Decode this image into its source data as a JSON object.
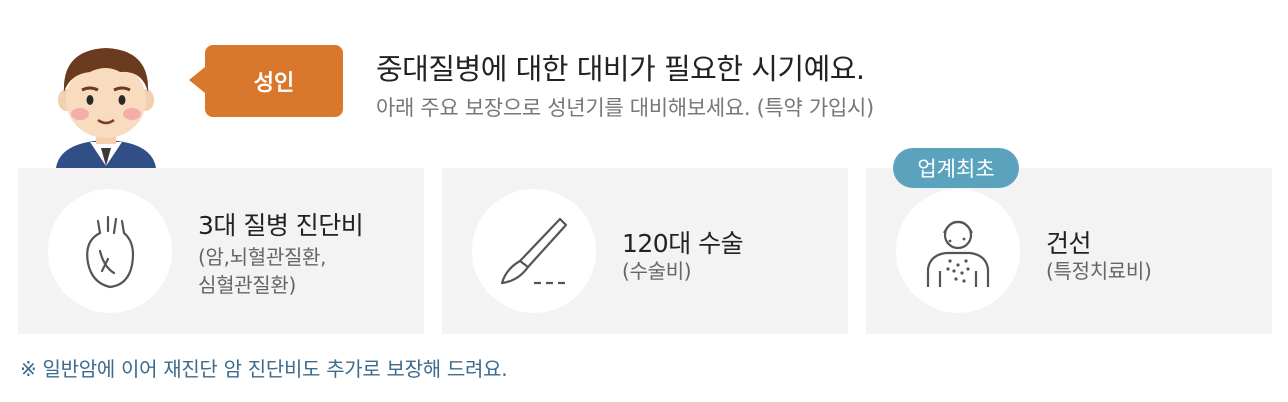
{
  "header": {
    "bubble_label": "성인",
    "headline": "중대질병에 대한 대비가 필요한 시기예요.",
    "subline": "아래 주요 보장으로 성년기를 대비해보세요. (특약 가입시)"
  },
  "cards": [
    {
      "icon": "heart-icon",
      "title": "3대 질병 진단비",
      "desc_line1": "(암,뇌혈관질환,",
      "desc_line2": "심혈관질환)"
    },
    {
      "icon": "scalpel-icon",
      "title": "120대 수술",
      "desc_line1": "(수술비)"
    },
    {
      "icon": "skin-patient-icon",
      "title": "건선",
      "desc_line1": "(특정치료비)",
      "badge": "업계최초"
    }
  ],
  "footnote": "※ 일반암에 이어 재진단 암 진단비도 추가로 보장해 드려요.",
  "colors": {
    "bubble": "#d9782d",
    "badge": "#5ba3bd",
    "card_bg": "#f3f3f3",
    "footnote": "#3d6b8e"
  }
}
